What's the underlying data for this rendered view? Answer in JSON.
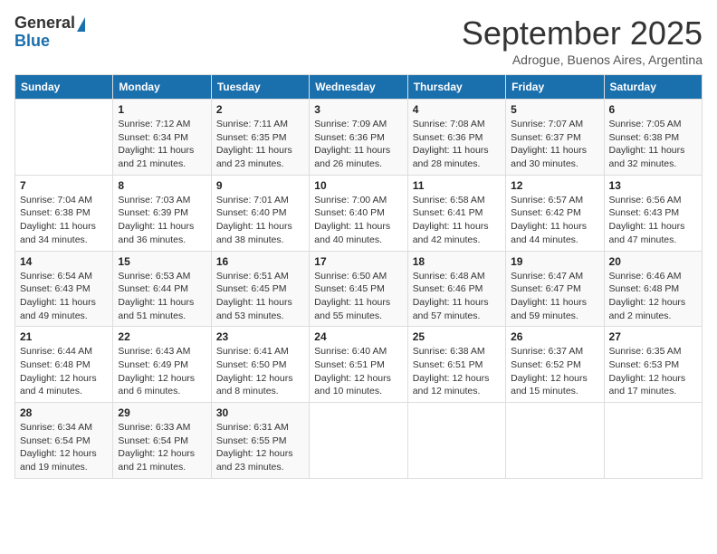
{
  "logo": {
    "general": "General",
    "blue": "Blue"
  },
  "title": "September 2025",
  "location": "Adrogue, Buenos Aires, Argentina",
  "days_of_week": [
    "Sunday",
    "Monday",
    "Tuesday",
    "Wednesday",
    "Thursday",
    "Friday",
    "Saturday"
  ],
  "weeks": [
    [
      {
        "day": "",
        "sunrise": "",
        "sunset": "",
        "daylight": ""
      },
      {
        "day": "1",
        "sunrise": "Sunrise: 7:12 AM",
        "sunset": "Sunset: 6:34 PM",
        "daylight": "Daylight: 11 hours and 21 minutes."
      },
      {
        "day": "2",
        "sunrise": "Sunrise: 7:11 AM",
        "sunset": "Sunset: 6:35 PM",
        "daylight": "Daylight: 11 hours and 23 minutes."
      },
      {
        "day": "3",
        "sunrise": "Sunrise: 7:09 AM",
        "sunset": "Sunset: 6:36 PM",
        "daylight": "Daylight: 11 hours and 26 minutes."
      },
      {
        "day": "4",
        "sunrise": "Sunrise: 7:08 AM",
        "sunset": "Sunset: 6:36 PM",
        "daylight": "Daylight: 11 hours and 28 minutes."
      },
      {
        "day": "5",
        "sunrise": "Sunrise: 7:07 AM",
        "sunset": "Sunset: 6:37 PM",
        "daylight": "Daylight: 11 hours and 30 minutes."
      },
      {
        "day": "6",
        "sunrise": "Sunrise: 7:05 AM",
        "sunset": "Sunset: 6:38 PM",
        "daylight": "Daylight: 11 hours and 32 minutes."
      }
    ],
    [
      {
        "day": "7",
        "sunrise": "Sunrise: 7:04 AM",
        "sunset": "Sunset: 6:38 PM",
        "daylight": "Daylight: 11 hours and 34 minutes."
      },
      {
        "day": "8",
        "sunrise": "Sunrise: 7:03 AM",
        "sunset": "Sunset: 6:39 PM",
        "daylight": "Daylight: 11 hours and 36 minutes."
      },
      {
        "day": "9",
        "sunrise": "Sunrise: 7:01 AM",
        "sunset": "Sunset: 6:40 PM",
        "daylight": "Daylight: 11 hours and 38 minutes."
      },
      {
        "day": "10",
        "sunrise": "Sunrise: 7:00 AM",
        "sunset": "Sunset: 6:40 PM",
        "daylight": "Daylight: 11 hours and 40 minutes."
      },
      {
        "day": "11",
        "sunrise": "Sunrise: 6:58 AM",
        "sunset": "Sunset: 6:41 PM",
        "daylight": "Daylight: 11 hours and 42 minutes."
      },
      {
        "day": "12",
        "sunrise": "Sunrise: 6:57 AM",
        "sunset": "Sunset: 6:42 PM",
        "daylight": "Daylight: 11 hours and 44 minutes."
      },
      {
        "day": "13",
        "sunrise": "Sunrise: 6:56 AM",
        "sunset": "Sunset: 6:43 PM",
        "daylight": "Daylight: 11 hours and 47 minutes."
      }
    ],
    [
      {
        "day": "14",
        "sunrise": "Sunrise: 6:54 AM",
        "sunset": "Sunset: 6:43 PM",
        "daylight": "Daylight: 11 hours and 49 minutes."
      },
      {
        "day": "15",
        "sunrise": "Sunrise: 6:53 AM",
        "sunset": "Sunset: 6:44 PM",
        "daylight": "Daylight: 11 hours and 51 minutes."
      },
      {
        "day": "16",
        "sunrise": "Sunrise: 6:51 AM",
        "sunset": "Sunset: 6:45 PM",
        "daylight": "Daylight: 11 hours and 53 minutes."
      },
      {
        "day": "17",
        "sunrise": "Sunrise: 6:50 AM",
        "sunset": "Sunset: 6:45 PM",
        "daylight": "Daylight: 11 hours and 55 minutes."
      },
      {
        "day": "18",
        "sunrise": "Sunrise: 6:48 AM",
        "sunset": "Sunset: 6:46 PM",
        "daylight": "Daylight: 11 hours and 57 minutes."
      },
      {
        "day": "19",
        "sunrise": "Sunrise: 6:47 AM",
        "sunset": "Sunset: 6:47 PM",
        "daylight": "Daylight: 11 hours and 59 minutes."
      },
      {
        "day": "20",
        "sunrise": "Sunrise: 6:46 AM",
        "sunset": "Sunset: 6:48 PM",
        "daylight": "Daylight: 12 hours and 2 minutes."
      }
    ],
    [
      {
        "day": "21",
        "sunrise": "Sunrise: 6:44 AM",
        "sunset": "Sunset: 6:48 PM",
        "daylight": "Daylight: 12 hours and 4 minutes."
      },
      {
        "day": "22",
        "sunrise": "Sunrise: 6:43 AM",
        "sunset": "Sunset: 6:49 PM",
        "daylight": "Daylight: 12 hours and 6 minutes."
      },
      {
        "day": "23",
        "sunrise": "Sunrise: 6:41 AM",
        "sunset": "Sunset: 6:50 PM",
        "daylight": "Daylight: 12 hours and 8 minutes."
      },
      {
        "day": "24",
        "sunrise": "Sunrise: 6:40 AM",
        "sunset": "Sunset: 6:51 PM",
        "daylight": "Daylight: 12 hours and 10 minutes."
      },
      {
        "day": "25",
        "sunrise": "Sunrise: 6:38 AM",
        "sunset": "Sunset: 6:51 PM",
        "daylight": "Daylight: 12 hours and 12 minutes."
      },
      {
        "day": "26",
        "sunrise": "Sunrise: 6:37 AM",
        "sunset": "Sunset: 6:52 PM",
        "daylight": "Daylight: 12 hours and 15 minutes."
      },
      {
        "day": "27",
        "sunrise": "Sunrise: 6:35 AM",
        "sunset": "Sunset: 6:53 PM",
        "daylight": "Daylight: 12 hours and 17 minutes."
      }
    ],
    [
      {
        "day": "28",
        "sunrise": "Sunrise: 6:34 AM",
        "sunset": "Sunset: 6:54 PM",
        "daylight": "Daylight: 12 hours and 19 minutes."
      },
      {
        "day": "29",
        "sunrise": "Sunrise: 6:33 AM",
        "sunset": "Sunset: 6:54 PM",
        "daylight": "Daylight: 12 hours and 21 minutes."
      },
      {
        "day": "30",
        "sunrise": "Sunrise: 6:31 AM",
        "sunset": "Sunset: 6:55 PM",
        "daylight": "Daylight: 12 hours and 23 minutes."
      },
      {
        "day": "",
        "sunrise": "",
        "sunset": "",
        "daylight": ""
      },
      {
        "day": "",
        "sunrise": "",
        "sunset": "",
        "daylight": ""
      },
      {
        "day": "",
        "sunrise": "",
        "sunset": "",
        "daylight": ""
      },
      {
        "day": "",
        "sunrise": "",
        "sunset": "",
        "daylight": ""
      }
    ]
  ]
}
